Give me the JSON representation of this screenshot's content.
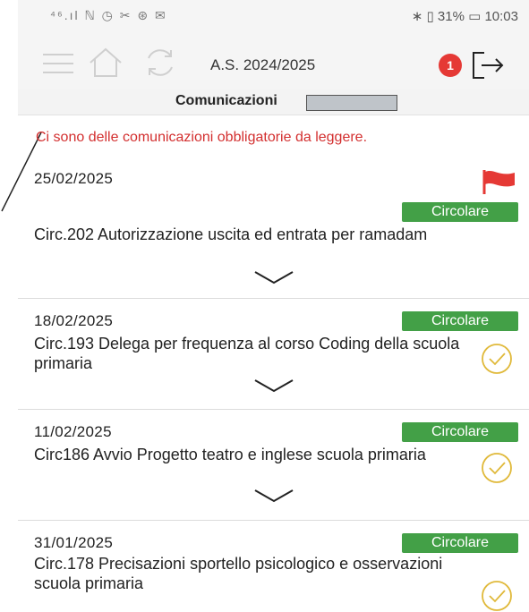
{
  "status_bar": {
    "left_icons": "⁴⁶.ıl ℕ ◷ ✂ ⊛ ✉",
    "right_text": "∗ ▯ 31% ▭ 10:03"
  },
  "header": {
    "school_year": "A.S. 2024/2025",
    "notification_count": "1"
  },
  "page": {
    "title": "Comunicazioni",
    "notice": "Ci sono delle comunicazioni obbligatorie da leggere."
  },
  "communications": [
    {
      "date": "25/02/2025",
      "tag": "Circolare",
      "title": "Circ.202 Autorizzazione uscita ed entrata per ramadam",
      "flagged": true,
      "read": false
    },
    {
      "date": "18/02/2025",
      "tag": "Circolare",
      "title": "Circ.193 Delega per frequenza al corso Coding della scuola primaria",
      "flagged": false,
      "read": true
    },
    {
      "date": "11/02/2025",
      "tag": "Circolare",
      "title": "Circ186 Avvio Progetto teatro e inglese scuola primaria",
      "flagged": false,
      "read": true
    },
    {
      "date": "31/01/2025",
      "tag": "Circolare",
      "title": "Circ.178 Precisazioni sportello psicologico e osservazioni scuola primaria",
      "flagged": false,
      "read": true
    }
  ],
  "colors": {
    "notice_red": "#d32f2f",
    "tag_green": "#43a047",
    "badge_red": "#e53935",
    "flag_red": "#e53935",
    "check_yellow": "#e0b93a"
  },
  "icons": {
    "menu": "hamburger-menu-icon",
    "home": "home-icon",
    "refresh": "refresh-icon",
    "logout": "logout-icon",
    "flag": "flag-icon",
    "expand": "chevron-down-icon",
    "read": "check-circle-icon"
  }
}
